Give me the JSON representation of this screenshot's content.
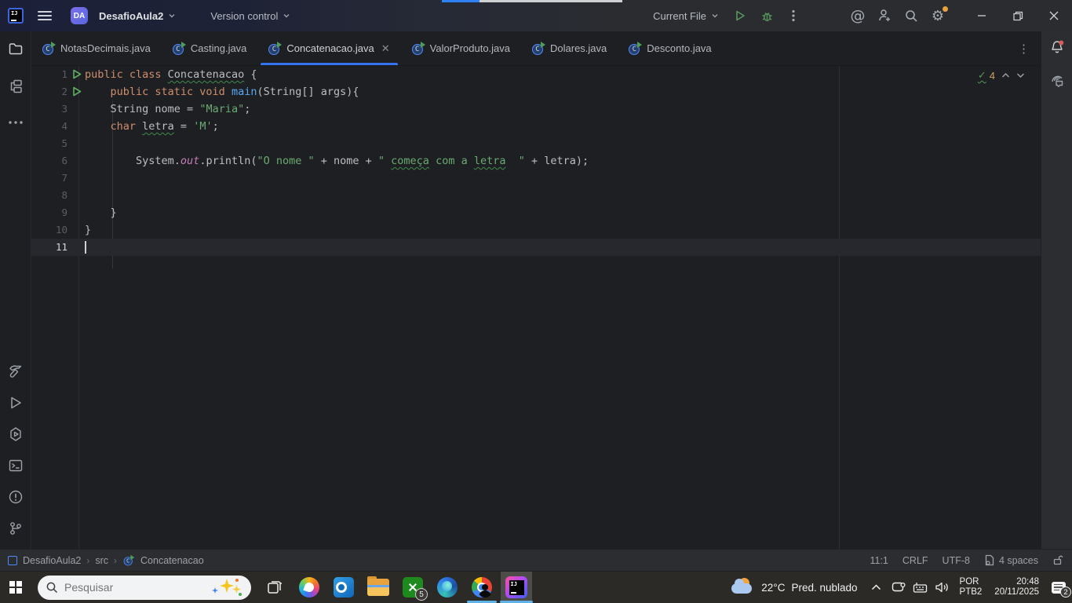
{
  "window": {
    "project_abbrev": "DA",
    "project_name": "DesafioAula2",
    "vcs_label": "Version control",
    "run_config_label": "Current File"
  },
  "tabs": [
    {
      "label": "NotasDecimais.java",
      "active": false,
      "close": false
    },
    {
      "label": "Casting.java",
      "active": false,
      "close": false
    },
    {
      "label": "Concatenacao.java",
      "active": true,
      "close": true
    },
    {
      "label": "ValorProduto.java",
      "active": false,
      "close": false
    },
    {
      "label": "Dolares.java",
      "active": false,
      "close": false
    },
    {
      "label": "Desconto.java",
      "active": false,
      "close": false
    }
  ],
  "editor": {
    "inspection_count": "4",
    "lines": [
      {
        "n": "1",
        "run": true,
        "caret": false,
        "tokens": [
          {
            "t": "public class ",
            "c": "k"
          },
          {
            "t": "Concatenacao",
            "c": "p",
            "w": true
          },
          {
            "t": " {",
            "c": "p"
          }
        ]
      },
      {
        "n": "2",
        "run": true,
        "caret": false,
        "tokens": [
          {
            "t": "    ",
            "c": "p"
          },
          {
            "t": "public static void ",
            "c": "k"
          },
          {
            "t": "main",
            "c": "f"
          },
          {
            "t": "(String[] args){",
            "c": "p"
          }
        ]
      },
      {
        "n": "3",
        "run": false,
        "caret": false,
        "tokens": [
          {
            "t": "    String nome = ",
            "c": "p"
          },
          {
            "t": "\"Maria\"",
            "c": "s"
          },
          {
            "t": ";",
            "c": "p"
          }
        ]
      },
      {
        "n": "4",
        "run": false,
        "caret": false,
        "tokens": [
          {
            "t": "    ",
            "c": "p"
          },
          {
            "t": "char ",
            "c": "k"
          },
          {
            "t": "letra",
            "c": "p",
            "w": true
          },
          {
            "t": " = ",
            "c": "p"
          },
          {
            "t": "'M'",
            "c": "s"
          },
          {
            "t": ";",
            "c": "p"
          }
        ]
      },
      {
        "n": "5",
        "run": false,
        "caret": false,
        "tokens": []
      },
      {
        "n": "6",
        "run": false,
        "caret": false,
        "tokens": [
          {
            "t": "        System.",
            "c": "p"
          },
          {
            "t": "out",
            "c": "o"
          },
          {
            "t": ".println(",
            "c": "p"
          },
          {
            "t": "\"O nome \"",
            "c": "s"
          },
          {
            "t": " + nome + ",
            "c": "p"
          },
          {
            "t": "\" ",
            "c": "s"
          },
          {
            "t": "começa",
            "c": "s",
            "w": true
          },
          {
            "t": " com a ",
            "c": "s"
          },
          {
            "t": "letra",
            "c": "s",
            "w": true
          },
          {
            "t": "  \"",
            "c": "s"
          },
          {
            "t": " + letra);",
            "c": "p"
          }
        ]
      },
      {
        "n": "7",
        "run": false,
        "caret": false,
        "tokens": []
      },
      {
        "n": "8",
        "run": false,
        "caret": false,
        "tokens": []
      },
      {
        "n": "9",
        "run": false,
        "caret": false,
        "tokens": [
          {
            "t": "    }",
            "c": "p"
          }
        ]
      },
      {
        "n": "10",
        "run": false,
        "caret": false,
        "tokens": [
          {
            "t": "}",
            "c": "p"
          }
        ]
      },
      {
        "n": "11",
        "run": false,
        "caret": true,
        "tokens": []
      }
    ]
  },
  "breadcrumbs": {
    "items": [
      "DesafioAula2",
      "src",
      "Concatenacao"
    ]
  },
  "status_bar": {
    "caret_position": "11:1",
    "line_separator": "CRLF",
    "encoding": "UTF-8",
    "indent": "4 spaces"
  },
  "taskbar": {
    "search_placeholder": "Pesquisar",
    "xbox_badge": "5",
    "weather_temp": "22°C",
    "weather_condition": "Pred. nublado",
    "lang_top": "POR",
    "lang_bottom": "PTB2",
    "time": "20:48",
    "date": "20/11/2025",
    "notification_count": "2"
  },
  "colors": {
    "accent_blue": "#3574f0",
    "keyword_orange": "#cf8e6d",
    "string_green": "#6aab73",
    "method_blue": "#56a8f5",
    "field_purple": "#c77dbb",
    "run_green": "#5fad65",
    "badge_red": "#db5c5c",
    "gear_dot_orange": "#e8a33d",
    "taskbar_indicator": "#5fb2e6"
  }
}
